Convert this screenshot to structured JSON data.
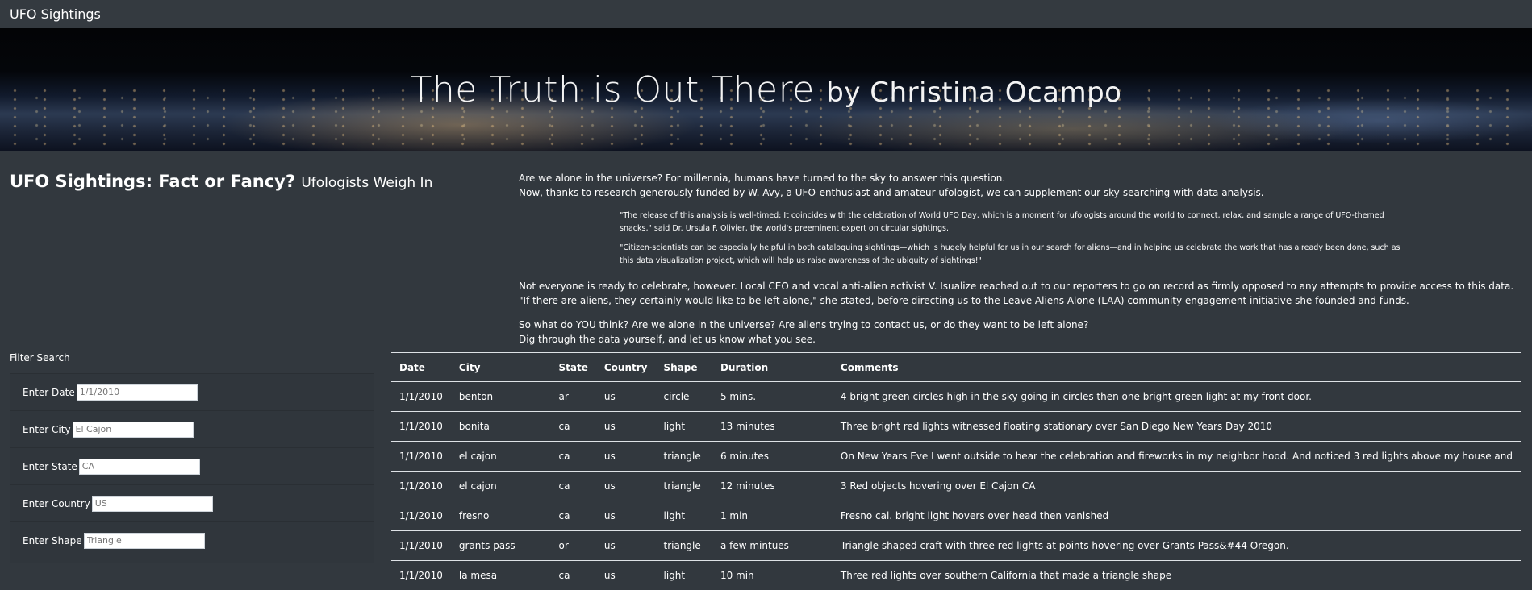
{
  "navbar": {
    "brand": "UFO Sightings"
  },
  "jumbotron": {
    "title": "The Truth is Out There",
    "byline": "by Christina Ocampo"
  },
  "article": {
    "heading": "UFO Sightings: Fact or Fancy?",
    "subheading": "Ufologists Weigh In",
    "intro_line1": "Are we alone in the universe? For millennia, humans have turned to the sky to answer this question.",
    "intro_line2": "Now, thanks to research generously funded by W. Avy, a UFO-enthusiast and amateur ufologist, we can supplement our sky-searching with data analysis.",
    "quote1": "\"The release of this analysis is well-timed: It coincides with the celebration of World UFO Day, which is a moment for ufologists around the world to connect, relax, and sample a range of UFO-themed snacks,\" said Dr. Ursula F. Olivier, the world's preeminent expert on circular sightings.",
    "quote2": "\"Citizen-scientists can be especially helpful in both cataloguing sightings—which is hugely helpful for us in our search for aliens—and in helping us celebrate the work that has already been done, such as this data visualization project, which will help us raise awareness of the ubiquity of sightings!\"",
    "para2": "Not everyone is ready to celebrate, however. Local CEO and vocal anti-alien activist V. Isualize reached out to our reporters to go on record as firmly opposed to any attempts to provide access to this data. \"If there are aliens, they certainly would like to be left alone,\" she stated, before directing us to the Leave Aliens Alone (LAA) community engagement initiative she founded and funds.",
    "para3_line1": "So what do YOU think? Are we alone in the universe? Are aliens trying to contact us, or do they want to be left alone?",
    "para3_line2": "Dig through the data yourself, and let us know what you see."
  },
  "filters": {
    "title": "Filter Search",
    "date_label": "Enter Date",
    "date_placeholder": "1/1/2010",
    "city_label": "Enter City",
    "city_placeholder": "El Cajon",
    "state_label": "Enter State",
    "state_placeholder": "CA",
    "country_label": "Enter Country",
    "country_placeholder": "US",
    "shape_label": "Enter Shape",
    "shape_placeholder": "Triangle"
  },
  "table": {
    "headers": [
      "Date",
      "City",
      "State",
      "Country",
      "Shape",
      "Duration",
      "Comments"
    ],
    "rows": [
      [
        "1/1/2010",
        "benton",
        "ar",
        "us",
        "circle",
        "5 mins.",
        "4 bright green circles high in the sky going in circles then one bright green light at my front door."
      ],
      [
        "1/1/2010",
        "bonita",
        "ca",
        "us",
        "light",
        "13 minutes",
        "Three bright red lights witnessed floating stationary over San Diego New Years Day 2010"
      ],
      [
        "1/1/2010",
        "el cajon",
        "ca",
        "us",
        "triangle",
        "6 minutes",
        "On New Years Eve I went outside to hear the celebration and fireworks in my neighbor hood. And noticed 3 red lights above my house and"
      ],
      [
        "1/1/2010",
        "el cajon",
        "ca",
        "us",
        "triangle",
        "12 minutes",
        "3 Red objects hovering over El Cajon CA"
      ],
      [
        "1/1/2010",
        "fresno",
        "ca",
        "us",
        "light",
        "1 min",
        "Fresno cal. bright light hovers over head then vanished"
      ],
      [
        "1/1/2010",
        "grants pass",
        "or",
        "us",
        "triangle",
        "a few mintues",
        "Triangle shaped craft with three red lights at points hovering over Grants Pass&#44 Oregon."
      ],
      [
        "1/1/2010",
        "la mesa",
        "ca",
        "us",
        "light",
        "10 min",
        "Three red lights over southern California that made a triangle shape"
      ]
    ]
  }
}
